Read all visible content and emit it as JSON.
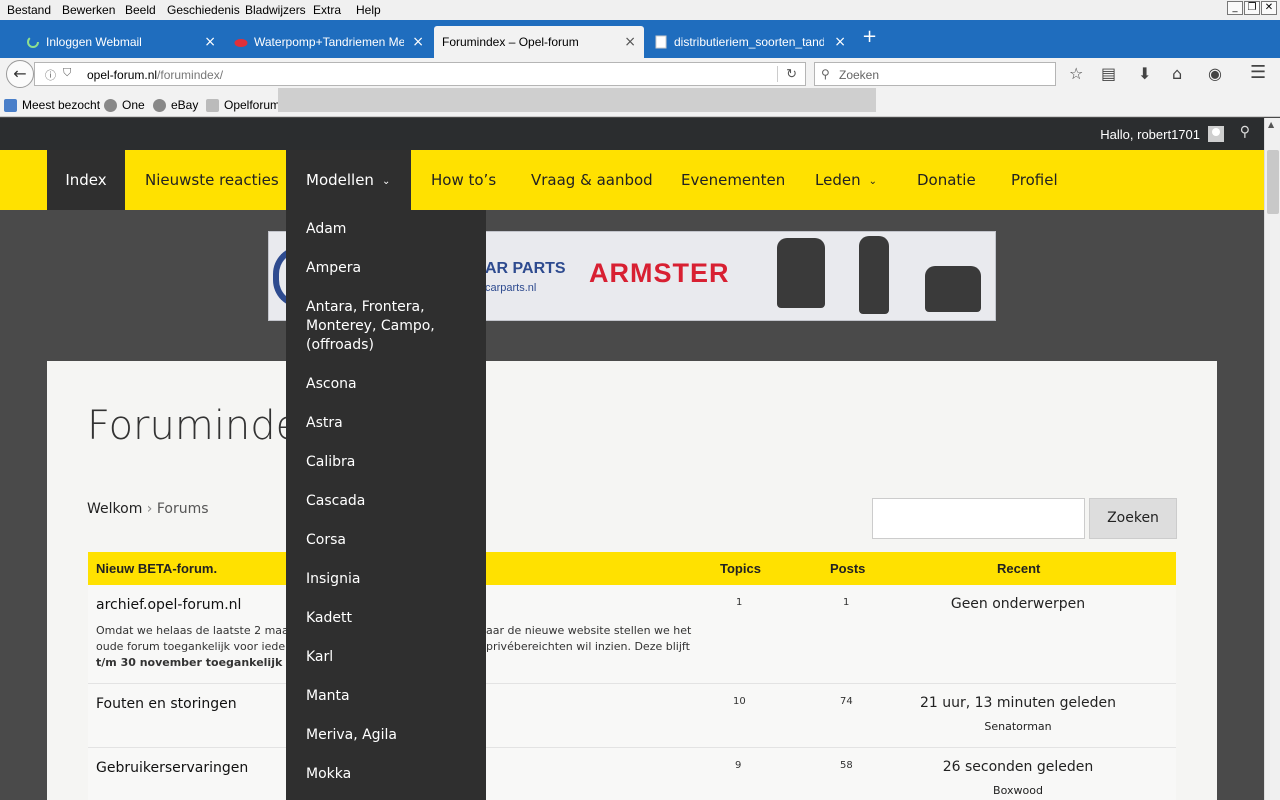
{
  "menubar": {
    "items": [
      "Bestand",
      "Bewerken",
      "Beeld",
      "Geschiedenis",
      "Bladwijzers",
      "Extra",
      "Help"
    ]
  },
  "tabs": [
    {
      "label": "Inloggen Webmail",
      "close": "×"
    },
    {
      "label": "Waterpomp+Tandriemen Met...",
      "close": "×"
    },
    {
      "label": "Forumindex – Opel-forum",
      "close": "×"
    },
    {
      "label": "distributieriem_soorten_tand...",
      "close": "×"
    }
  ],
  "new_tab": "+",
  "urlbar": {
    "host": "opel-forum.nl",
    "path": "/forumindex/"
  },
  "search": {
    "placeholder": "Zoeken"
  },
  "bookmarks": [
    "Meest bezocht",
    "One",
    "eBay",
    "Opelforum"
  ],
  "topstrip": {
    "greeting": "Hallo, robert1701"
  },
  "nav": {
    "items": [
      "Index",
      "Nieuwste reacties",
      "Modellen",
      "How to’s",
      "Vraag & aanbod",
      "Evenementen",
      "Leden",
      "Donatie",
      "Profiel"
    ]
  },
  "banner": {
    "carparts": "AR PARTS",
    "carparts_sub": "carparts.nl",
    "brand": "ARMSTER"
  },
  "page": {
    "title": "Forumindex",
    "breadcrumb_home": "Welkom",
    "breadcrumb_sep": "›",
    "breadcrumb_current": "Forums",
    "search_button": "Zoeken"
  },
  "table": {
    "headers": {
      "forum": "Nieuw BETA-forum.",
      "topics": "Topics",
      "posts": "Posts",
      "recent": "Recent"
    },
    "rows": [
      {
        "name": "archief.opel-forum.nl",
        "desc_lines": [
          "Omdat we helaas de laatste 2 maand",
          "aar de nieuwe website stellen we het",
          "oude forum toegankelijk voor iedere",
          "privébereichten wil inzien. Deze blijft",
          "t/m 30 november toegankelijk http:/"
        ],
        "topics": "1",
        "posts": "1",
        "recent": "Geen onderwerpen",
        "user": ""
      },
      {
        "name": "Fouten en storingen",
        "topics": "10",
        "posts": "74",
        "recent": "21 uur, 13 minuten geleden",
        "user": "Senatorman"
      },
      {
        "name": "Gebruikerservaringen",
        "topics": "9",
        "posts": "58",
        "recent": "26 seconden geleden",
        "user": "Boxwood"
      }
    ]
  },
  "dropdown": {
    "items": [
      "Adam",
      "Ampera",
      "Antara, Frontera, Monterey, Campo, (offroads)",
      "Ascona",
      "Astra",
      "Calibra",
      "Cascada",
      "Corsa",
      "Insignia",
      "Kadett",
      "Karl",
      "Manta",
      "Meriva, Agila",
      "Mokka"
    ]
  },
  "colors": {
    "accent_yellow": "#ffe100",
    "dark": "#2f2f2f",
    "firefox_blue": "#1f6dbe"
  }
}
